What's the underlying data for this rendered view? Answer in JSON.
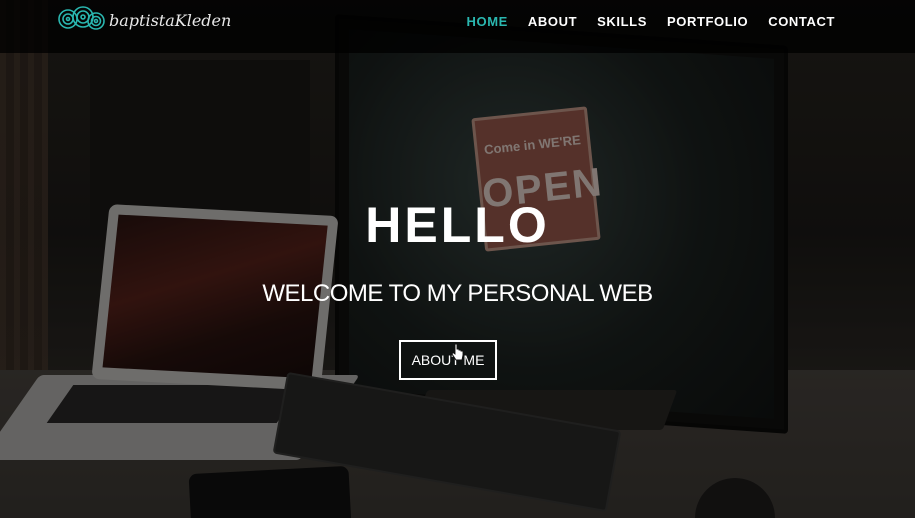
{
  "brand": {
    "name": "baptistaKleden",
    "logo_icon": "rose-flowers-logo",
    "accent_color": "#2ab7b0"
  },
  "nav": {
    "items": [
      {
        "label": "HOME",
        "active": true
      },
      {
        "label": "ABOUT",
        "active": false
      },
      {
        "label": "SKILLS",
        "active": false
      },
      {
        "label": "PORTFOLIO",
        "active": false
      },
      {
        "label": "CONTACT",
        "active": false
      }
    ]
  },
  "hero": {
    "title": "HELLO",
    "subtitle": "WELCOME TO MY PERSONAL WEB",
    "button_label": "ABOUT ME",
    "background_sign_line1": "Come in WE'RE",
    "background_sign_line2": "OPEN"
  }
}
